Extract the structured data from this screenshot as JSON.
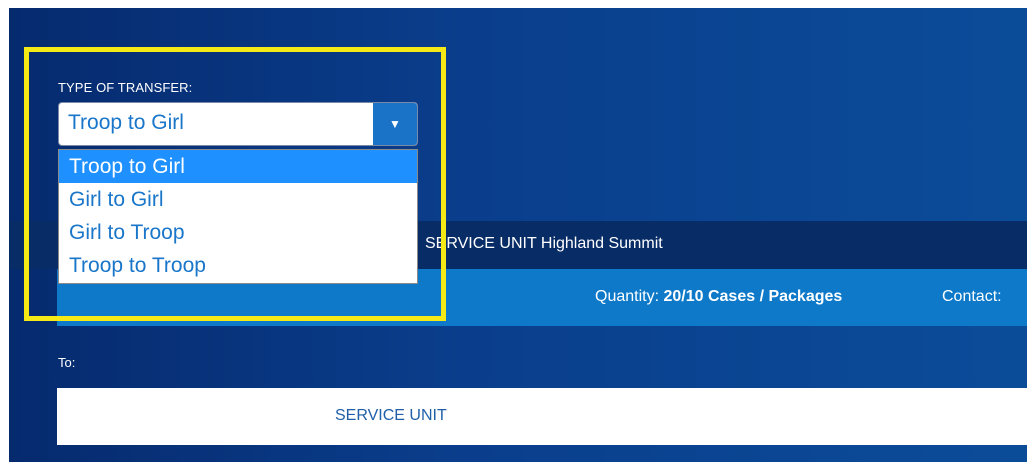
{
  "transfer": {
    "label": "TYPE OF TRANSFER:",
    "selected_value": "Troop to Girl",
    "options": [
      "Troop to Girl",
      "Girl to Girl",
      "Girl to Troop",
      "Troop to Troop"
    ],
    "selected_index": 0
  },
  "from_section": {
    "service_unit_text": "SERVICE UNIT Highland Summit",
    "quantity_label": "Quantity:",
    "quantity_value": "20/10 Cases / Packages",
    "contact_label": "Contact:"
  },
  "to_section": {
    "label": "To:",
    "service_unit_text": "SERVICE UNIT"
  },
  "icons": {
    "dropdown_arrow": "triangle-down-icon"
  },
  "colors": {
    "panel_bg": "#0a3e8c",
    "service_row_bg": "#082c66",
    "quantity_row_bg": "#0d79c8",
    "option_text": "#1976c9",
    "selected_option_bg": "#1e90ff",
    "highlight": "#f5ea16"
  }
}
